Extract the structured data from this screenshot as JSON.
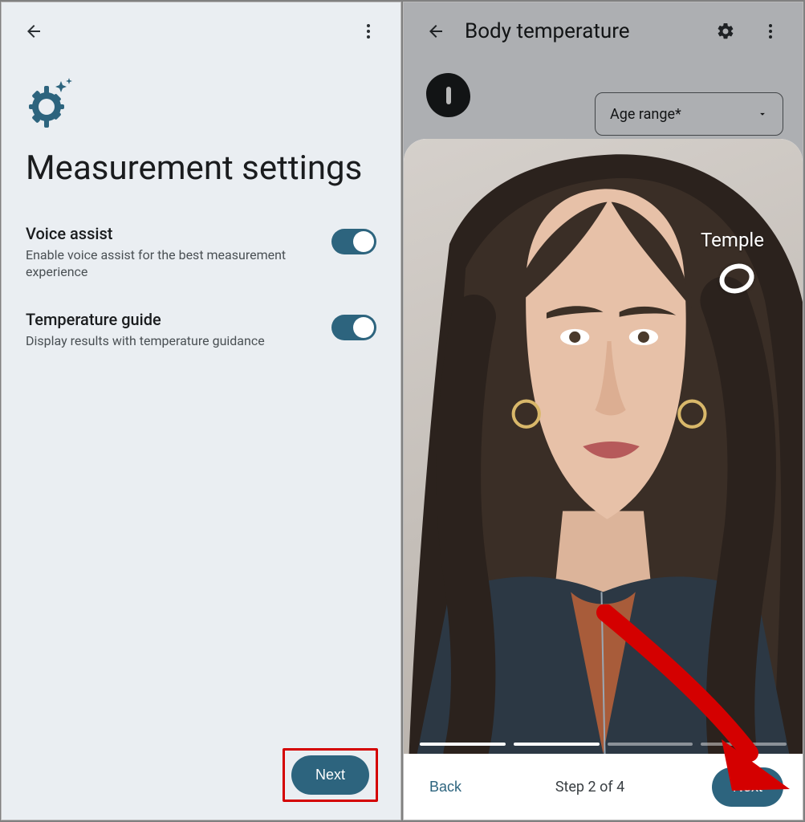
{
  "colors": {
    "accent": "#2d647e",
    "highlight": "#d40000"
  },
  "left": {
    "title": "Measurement settings",
    "voice": {
      "title": "Voice assist",
      "desc": "Enable voice assist for the best measurement experience",
      "on": true
    },
    "guide": {
      "title": "Temperature guide",
      "desc": "Display results with temperature guidance",
      "on": true
    },
    "next_label": "Next"
  },
  "right": {
    "header_title": "Body temperature",
    "age_label": "Age range*",
    "temple_label": "Temple",
    "progress": {
      "completed": 2,
      "total": 4
    },
    "back_label": "Back",
    "step_label": "Step 2 of 4",
    "next_label": "Next"
  }
}
